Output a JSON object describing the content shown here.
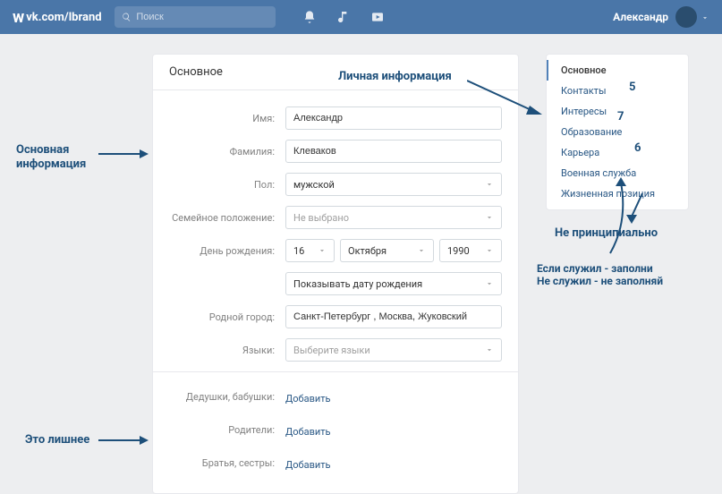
{
  "topbar": {
    "logo": "w",
    "url": "vk.com/lbrand",
    "search_placeholder": "Поиск",
    "user_name": "Александр"
  },
  "page_title": "Основное",
  "form": {
    "name_label": "Имя:",
    "name_value": "Александр",
    "surname_label": "Фамилия:",
    "surname_value": "Клеваков",
    "gender_label": "Пол:",
    "gender_value": "мужской",
    "marital_label": "Семейное положение:",
    "marital_value": "Не выбрано",
    "birthday_label": "День рождения:",
    "birthday_day": "16",
    "birthday_month": "Октября",
    "birthday_year": "1990",
    "birthday_visibility": "Показывать дату рождения",
    "hometown_label": "Родной город:",
    "hometown_value": "Санкт-Петербург , Москва, Жуковский",
    "languages_label": "Языки:",
    "languages_value": "Выберите языки",
    "grandparents_label": "Дедушки, бабушки:",
    "parents_label": "Родители:",
    "siblings_label": "Братья, сестры:",
    "add_link": "Добавить"
  },
  "sidebar": {
    "items": [
      "Основное",
      "Контакты",
      "Интересы",
      "Образование",
      "Карьера",
      "Военная служба",
      "Жизненная позиция"
    ]
  },
  "annotations": {
    "personal_info": "Личная информация",
    "main_info": "Основная\nинформация",
    "extra": "Это лишнее",
    "not_important": "Не принципиально",
    "served": "Если служил - заполни\nНе служил - не заполняй",
    "n5": "5",
    "n6": "6",
    "n7": "7"
  }
}
